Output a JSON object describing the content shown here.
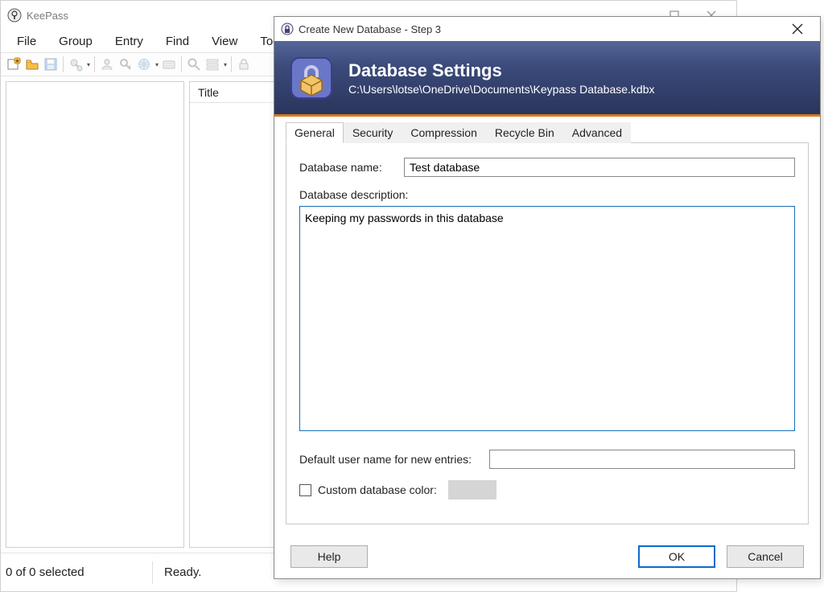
{
  "main": {
    "title": "KeePass",
    "menu": {
      "file": "File",
      "group": "Group",
      "entry": "Entry",
      "find": "Find",
      "view": "View",
      "tools": "Tools"
    },
    "columns": {
      "title": "Title"
    },
    "status": {
      "selection": "0 of 0 selected",
      "ready": "Ready."
    }
  },
  "dialog": {
    "title": "Create New Database - Step 3",
    "header": {
      "title": "Database Settings",
      "path": "C:\\Users\\lotse\\OneDrive\\Documents\\Keypass  Database.kdbx"
    },
    "tabs": {
      "general": "General",
      "security": "Security",
      "compression": "Compression",
      "recyclebin": "Recycle Bin",
      "advanced": "Advanced"
    },
    "general": {
      "name_label": "Database name:",
      "name_value": "Test database",
      "desc_label": "Database description:",
      "desc_value": "Keeping my passwords in this database",
      "defuser_label": "Default user name for new entries:",
      "defuser_value": "",
      "color_label": "Custom database color:"
    },
    "buttons": {
      "help": "Help",
      "ok": "OK",
      "cancel": "Cancel"
    }
  }
}
